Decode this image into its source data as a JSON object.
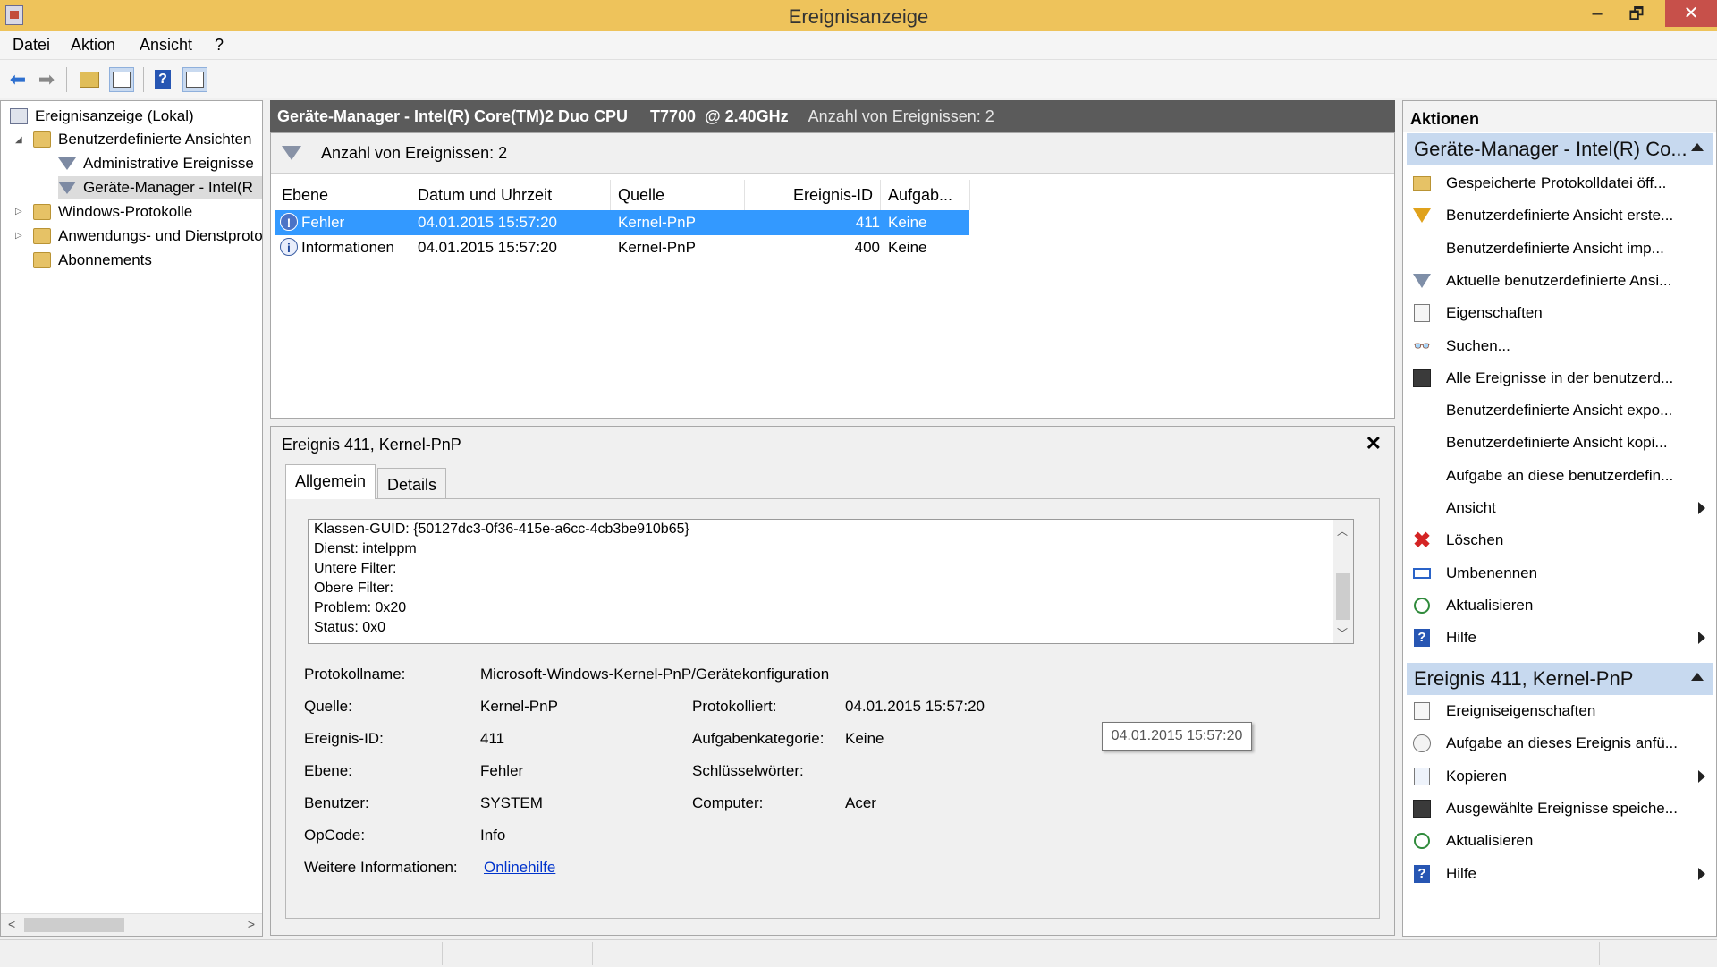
{
  "window": {
    "title": "Ereignisanzeige",
    "minimize": "–",
    "maximize": "🗗",
    "close": "✕"
  },
  "menu": [
    "Datei",
    "Aktion",
    "Ansicht",
    "?"
  ],
  "tree": {
    "root": "Ereignisanzeige (Lokal)",
    "custom_views": "Benutzerdefinierte Ansichten",
    "admin_events": "Administrative Ereignisse",
    "device_manager": "Geräte-Manager - Intel(R",
    "windows_logs": "Windows-Protokolle",
    "app_logs": "Anwendungs- und Dienstprotokolle",
    "subscriptions": "Abonnements"
  },
  "center": {
    "header_title": "Geräte-Manager - Intel(R) Core(TM)2 Duo CPU     T7700  @ 2.40GHz",
    "header_count": "Anzahl von Ereignissen: 2",
    "filter_text": "Anzahl von Ereignissen: 2",
    "columns": [
      "Ebene",
      "Datum und Uhrzeit",
      "Quelle",
      "Ereignis-ID",
      "Aufgab..."
    ],
    "rows": [
      {
        "level": "Fehler",
        "datetime": "04.01.2015 15:57:20",
        "source": "Kernel-PnP",
        "id": "411",
        "task": "Keine",
        "icon": "!"
      },
      {
        "level": "Informationen",
        "datetime": "04.01.2015 15:57:20",
        "source": "Kernel-PnP",
        "id": "400",
        "task": "Keine",
        "icon": "i"
      }
    ]
  },
  "detail": {
    "title": "Ereignis 411, Kernel-PnP",
    "close": "✕",
    "tabs": [
      "Allgemein",
      "Details"
    ],
    "description": [
      "Klassen-GUID: {50127dc3-0f36-415e-a6cc-4cb3be910b65}",
      "Dienst: intelppm",
      "Untere Filter:",
      "Obere Filter:",
      "Problem: 0x20",
      "Status: 0x0"
    ],
    "props": {
      "log_name_label": "Protokollname:",
      "log_name": "Microsoft-Windows-Kernel-PnP/Gerätekonfiguration",
      "source_label": "Quelle:",
      "source": "Kernel-PnP",
      "logged_label": "Protokolliert:",
      "logged": "04.01.2015 15:57:20",
      "event_id_label": "Ereignis-ID:",
      "event_id": "411",
      "task_label": "Aufgabenkategorie:",
      "task": "Keine",
      "level_label": "Ebene:",
      "level": "Fehler",
      "keywords_label": "Schlüsselwörter:",
      "keywords": "",
      "user_label": "Benutzer:",
      "user": "SYSTEM",
      "computer_label": "Computer:",
      "computer": "Acer",
      "opcode_label": "OpCode:",
      "opcode": "Info",
      "more_info_label": "Weitere Informationen:",
      "more_info_link": "Onlinehilfe"
    },
    "tooltip": "04.01.2015 15:57:20"
  },
  "actions": {
    "header": "Aktionen",
    "section1_title": "Geräte-Manager - Intel(R) Co...",
    "section1": [
      {
        "label": "Gespeicherte Protokolldatei öff...",
        "icon": "open-folder-icon"
      },
      {
        "label": "Benutzerdefinierte Ansicht erste...",
        "icon": "filter-create-icon"
      },
      {
        "label": "Benutzerdefinierte Ansicht imp...",
        "icon": ""
      },
      {
        "label": "Aktuelle benutzerdefinierte Ansi...",
        "icon": "filter-icon"
      },
      {
        "label": "Eigenschaften",
        "icon": "properties-icon"
      },
      {
        "label": "Suchen...",
        "icon": "binoculars-icon"
      },
      {
        "label": "Alle Ereignisse in der benutzerd...",
        "icon": "save-icon"
      },
      {
        "label": "Benutzerdefinierte Ansicht expo...",
        "icon": ""
      },
      {
        "label": "Benutzerdefinierte Ansicht kopi...",
        "icon": ""
      },
      {
        "label": "Aufgabe an diese benutzerdefin...",
        "icon": ""
      },
      {
        "label": "Ansicht",
        "icon": ""
      },
      {
        "label": "Löschen",
        "icon": "delete-icon"
      },
      {
        "label": "Umbenennen",
        "icon": "rename-icon"
      },
      {
        "label": "Aktualisieren",
        "icon": "refresh-icon"
      },
      {
        "label": "Hilfe",
        "icon": "help-icon"
      }
    ],
    "section2_title": "Ereignis 411, Kernel-PnP",
    "section2": [
      {
        "label": "Ereigniseigenschaften",
        "icon": "properties-icon"
      },
      {
        "label": "Aufgabe an dieses Ereignis anfü...",
        "icon": "task-icon"
      },
      {
        "label": "Kopieren",
        "icon": "copy-icon"
      },
      {
        "label": "Ausgewählte Ereignisse speiche...",
        "icon": "save-icon"
      },
      {
        "label": "Aktualisieren",
        "icon": "refresh-icon"
      },
      {
        "label": "Hilfe",
        "icon": "help-icon"
      }
    ]
  },
  "colors": {
    "titlebar": "#eec35b",
    "selection": "#3399ff",
    "section_header": "#c7d9ef",
    "center_header": "#5b5b5b",
    "close_button": "#c7504a"
  }
}
